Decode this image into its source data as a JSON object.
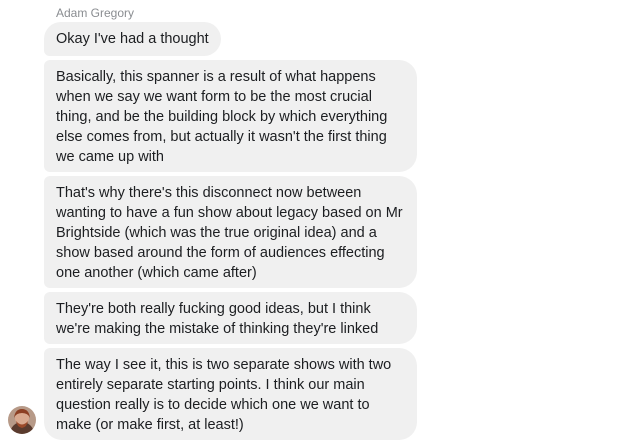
{
  "conversation": {
    "sender_name": "Adam Gregory",
    "messages": [
      "Okay I've had a thought",
      "Basically, this spanner is a result of what happens when we say we want form to be the most crucial thing, and be the building block by which everything else comes from, but actually it wasn't the first thing we came up with",
      "That's why there's this disconnect now between wanting to have a fun show about legacy based on Mr Brightside (which was the true original idea) and a show based around the form of audiences effecting one another (which came after)",
      "They're both really fucking good ideas, but I think we're making the mistake of thinking they're linked",
      "The way I see it, this is two separate shows with two entirely separate starting points. I think our main question really is to decide which one we want to make (or make first, at least!)"
    ],
    "colors": {
      "bubble_background": "#f0f0f0",
      "bubble_text": "#1c1e21",
      "sender_name_text": "#8a8d91"
    },
    "avatar_icon": "user-avatar-photo"
  }
}
